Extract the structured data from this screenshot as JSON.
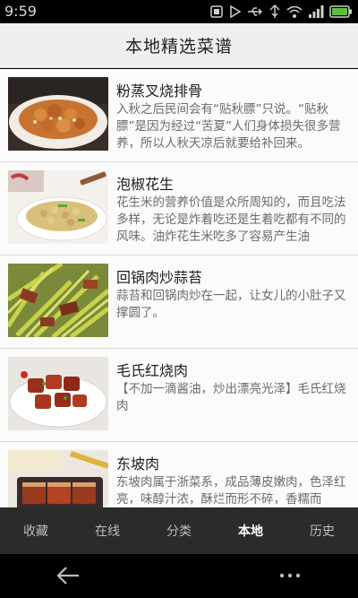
{
  "status_bar": {
    "time": "9:59",
    "icons": [
      "usb-debug-icon",
      "play-icon",
      "usb-icon",
      "transfer-icon",
      "wifi-icon",
      "signal-icon",
      "battery-icon"
    ]
  },
  "header": {
    "title": "本地精选菜谱"
  },
  "recipes": [
    {
      "name": "粉蒸叉烧排骨",
      "description": "入秋之后民间会有“贴秋膘”只说。“贴秋膘”是因为经过“苦夏”人们身体损失很多营养，所以人秋天凉后就要给补回来。"
    },
    {
      "name": "泡椒花生",
      "description": "花生米的营养价值是众所周知的，而且吃法多样，无论是炸着吃还是生着吃都有不同的风味。油炸花生米吃多了容易产生油"
    },
    {
      "name": "回锅肉炒蒜苔",
      "description": "蒜苔和回锅肉炒在一起，让女儿的小肚子又撑圆了。"
    },
    {
      "name": "毛氏红烧肉",
      "description": "【不加一滴酱油，炒出漂亮光泽】毛氏红烧肉"
    },
    {
      "name": "东坡肉",
      "description": "东坡肉属于浙菜系，成品薄皮嫩肉，色泽红亮，味醇汁浓，酥烂而形不碎，香糯而"
    }
  ],
  "tabs": [
    {
      "label": "收藏",
      "active": false
    },
    {
      "label": "在线",
      "active": false
    },
    {
      "label": "分类",
      "active": false
    },
    {
      "label": "本地",
      "active": true
    },
    {
      "label": "历史",
      "active": false
    }
  ],
  "nav_bar": {
    "icons": [
      "back-arrow-icon",
      "more-dots-icon"
    ]
  },
  "colors": {
    "tab_bar": "#2b2b2b",
    "title_bar": "#efefef",
    "list_bg": "#fbfbfb"
  }
}
